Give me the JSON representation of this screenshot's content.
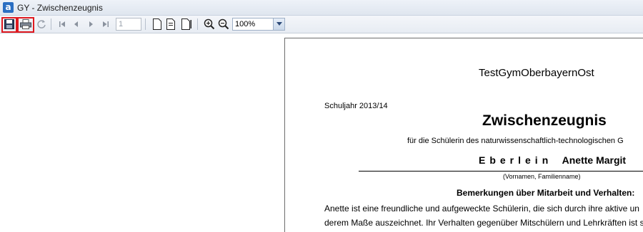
{
  "window": {
    "title": "GY - Zwischenzeugnis",
    "app_icon_letter": "a"
  },
  "toolbar": {
    "buttons": [
      "save-icon",
      "print-icon",
      "refresh-icon",
      "first-page-icon",
      "previous-page-icon",
      "next-page-icon",
      "last-page-icon",
      "single-page-icon",
      "two-page-icon",
      "page-width-icon",
      "zoom-in-icon",
      "zoom-out-icon"
    ],
    "page_number": "1",
    "zoom": "100%",
    "highlight_color": "#e0191f"
  },
  "document": {
    "school": "TestGymOberbayernOst",
    "school_year": "Schuljahr 2013/14",
    "title": "Zwischenzeugnis",
    "subtitle": "für die Schülerin des naturwissenschaftlich-technologischen G",
    "surname": "Eberlein",
    "given_names": "Anette Margit",
    "name_caption": "(Vornamen, Familienname)",
    "section_heading": "Bemerkungen über Mitarbeit und Verhalten:",
    "remark_lines": [
      "Anette ist eine freundliche und aufgeweckte Schülerin, die sich durch ihre aktive un",
      "derem Maße auszeichnet. Ihr Verhalten gegenüber Mitschülern und Lehrkräften ist s"
    ]
  }
}
